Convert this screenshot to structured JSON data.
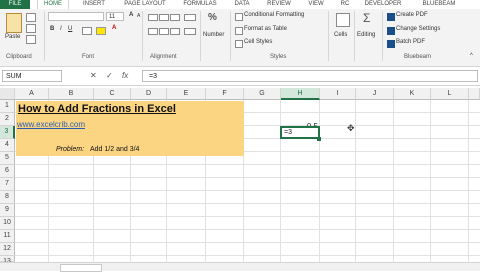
{
  "tabs": [
    "FILE",
    "HOME",
    "INSERT",
    "PAGE LAYOUT",
    "FORMULAS",
    "DATA",
    "REVIEW",
    "VIEW",
    "RC",
    "DEVELOPER",
    "BLUEBEAM"
  ],
  "ribbon": {
    "paste_label": "Paste",
    "font_size": "11",
    "conditional_formatting": "Conditional Formatting",
    "format_as_table": "Format as Table",
    "cell_styles": "Cell Styles",
    "number_label": "Number",
    "cells_label": "Cells",
    "editing_label": "Editing",
    "create_pdf": "Create PDF",
    "change_settings": "Change Settings",
    "batch_pdf": "Batch PDF",
    "groups": {
      "clipboard": "Clipboard",
      "font": "Font",
      "alignment": "Alignment",
      "styles": "Styles",
      "bluebeam": "Bluebeam"
    }
  },
  "formula_bar": {
    "name_box": "SUM",
    "formula": "=3",
    "cancel": "✕",
    "enter": "✓",
    "fx": "fx"
  },
  "columns": [
    "A",
    "B",
    "C",
    "D",
    "E",
    "F",
    "G",
    "H",
    "I",
    "J",
    "K",
    "L"
  ],
  "rows": [
    "1",
    "2",
    "3",
    "4",
    "5",
    "6",
    "7",
    "8",
    "9",
    "10",
    "11",
    "12",
    "13"
  ],
  "cells": {
    "title": "How to Add Fractions in Excel",
    "link": "www.excelcrib.com",
    "problem_label": "Problem:",
    "problem_text": "Add 1/2 and 3/4",
    "h2": "0.5",
    "h3": "=3"
  },
  "colors": {
    "accent": "#217346",
    "highlight": "#fbd582"
  }
}
